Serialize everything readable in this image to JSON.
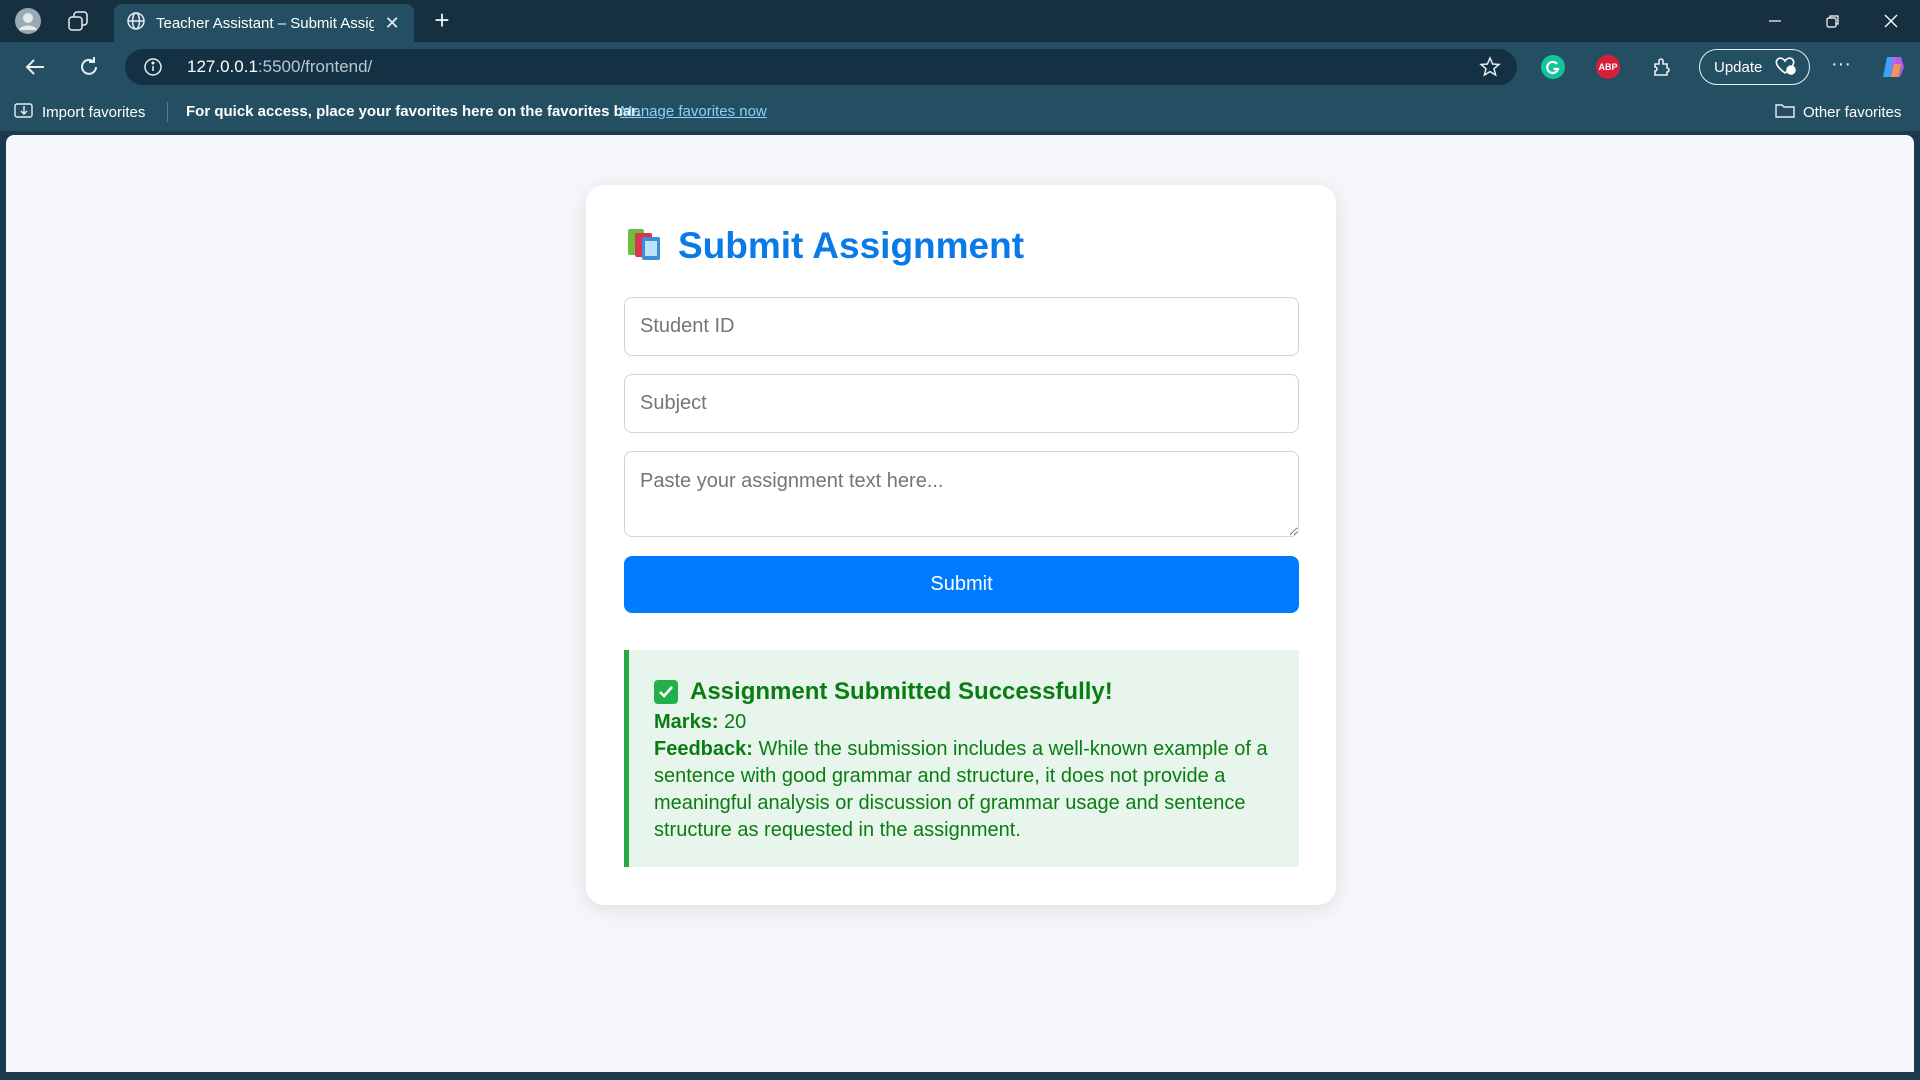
{
  "browser": {
    "tab_title": "Teacher Assistant – Submit Assignment",
    "tab_close": "✕",
    "new_tab": "+",
    "url_host": "127.0.0.1",
    "url_rest": ":5500/frontend/",
    "update_label": "Update",
    "more_label": "···",
    "extensions": {
      "abp_label": "ABP"
    },
    "favorites": {
      "import_label": "Import favorites",
      "message": "For quick access, place your favorites here on the favorites bar.",
      "manage_link": "Manage favorites now",
      "other_label": "Other favorites"
    }
  },
  "page": {
    "heading": "Submit Assignment",
    "heading_icon": "books-icon",
    "student_id_placeholder": "Student ID",
    "subject_placeholder": "Subject",
    "assignment_placeholder": "Paste your assignment text here...",
    "submit_label": "Submit",
    "result": {
      "title": "Assignment Submitted Successfully!",
      "marks_label": "Marks:",
      "marks_value": "20",
      "feedback_label": "Feedback:",
      "feedback_text": "While the submission includes a well-known example of a sentence with good grammar and structure, it does not provide a meaningful analysis or discussion of grammar usage and sentence structure as requested in the assignment."
    }
  },
  "colors": {
    "accent": "#007bff",
    "heading": "#0a7ae6",
    "success": "#28a745",
    "success_text": "#0a7d12",
    "success_bg": "#e7f5ec"
  }
}
